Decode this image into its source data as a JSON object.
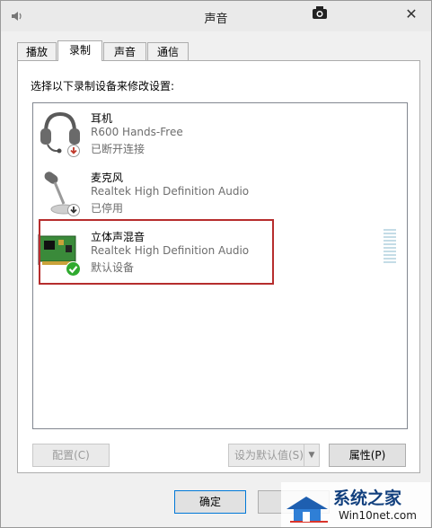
{
  "window": {
    "title": "声音"
  },
  "tabs": [
    {
      "label": "播放",
      "active": false
    },
    {
      "label": "录制",
      "active": true
    },
    {
      "label": "声音",
      "active": false
    },
    {
      "label": "通信",
      "active": false
    }
  ],
  "instruction": "选择以下录制设备来修改设置:",
  "devices": [
    {
      "name": "耳机",
      "description": "R600 Hands-Free",
      "status": "已断开连接",
      "icon": "headset-icon",
      "badge": "disconnected-badge"
    },
    {
      "name": "麦克风",
      "description": "Realtek High Definition Audio",
      "status": "已停用",
      "icon": "microphone-icon",
      "badge": "disabled-badge"
    },
    {
      "name": "立体声混音",
      "description": "Realtek High Definition Audio",
      "status": "默认设备",
      "icon": "sound-card-icon",
      "badge": "default-check-badge",
      "selected": true
    }
  ],
  "buttons": {
    "configure": "配置(C)",
    "set_default": "设为默认值(S)",
    "properties": "属性(P)",
    "ok": "确定"
  },
  "watermark": {
    "line1": "系统之家",
    "line2": "Win10net.com"
  },
  "colors": {
    "highlight": "#b62d2d",
    "accent": "#0078d7"
  }
}
